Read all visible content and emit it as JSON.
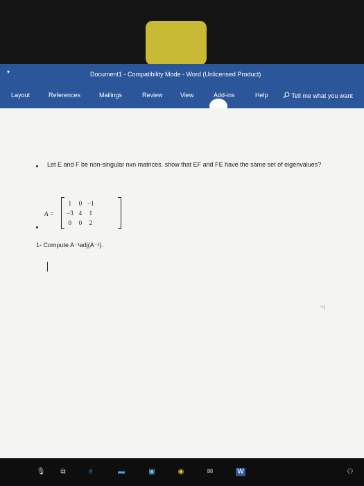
{
  "window": {
    "title": "Document1  -  Compatibility Mode  -  Word (Unlicensed Product)",
    "corner_mark": "▾"
  },
  "ribbon": {
    "tabs": [
      {
        "label": "Layout"
      },
      {
        "label": "References"
      },
      {
        "label": "Mailings"
      },
      {
        "label": "Review"
      },
      {
        "label": "View"
      },
      {
        "label": "Add-ins"
      },
      {
        "label": "Help"
      }
    ],
    "tell_me": "Tell me what you want"
  },
  "document": {
    "question": "Let E and F be non-singular nxn matrices. show that EF and FE have the same set of eigenvalues?",
    "matrix": {
      "label": "A =",
      "rows": [
        [
          "1",
          "0",
          "−1"
        ],
        [
          "−3",
          "4",
          "1"
        ],
        [
          "0",
          "0",
          "2"
        ]
      ]
    },
    "task": "1-  Compute A⁻¹adj(A⁻¹).",
    "move_mark": "⁼I"
  },
  "taskbar": {
    "icons": [
      {
        "name": "mic-icon",
        "glyph": "🎙"
      },
      {
        "name": "task-view-icon",
        "glyph": "⧉"
      },
      {
        "name": "edge-icon",
        "glyph": "e"
      },
      {
        "name": "file-explorer-icon",
        "glyph": "▬"
      },
      {
        "name": "store-icon",
        "glyph": "▣"
      },
      {
        "name": "chrome-icon",
        "glyph": "◉"
      },
      {
        "name": "mail-icon",
        "glyph": "✉"
      },
      {
        "name": "word-icon",
        "glyph": "W"
      },
      {
        "name": "people-icon",
        "glyph": "⚇"
      }
    ]
  },
  "colors": {
    "word_blue": "#2b579a",
    "document_bg": "#f4f4f2",
    "taskbar": "#0e0e0e"
  }
}
